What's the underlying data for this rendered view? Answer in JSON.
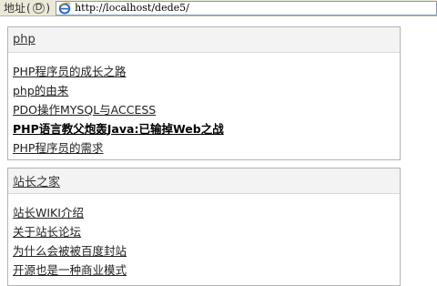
{
  "address_bar": {
    "label": "地址",
    "access_key": "D",
    "url": "http://localhost/dede5/"
  },
  "sections": [
    {
      "title": "php",
      "items": [
        {
          "label": "PHP程序员的成长之路",
          "bold": false
        },
        {
          "label": "php的由来",
          "bold": false
        },
        {
          "label": "PDO操作MYSQL与ACCESS",
          "bold": false
        },
        {
          "label": "PHP语言教父炮轰Java:已输掉Web之战",
          "bold": true
        },
        {
          "label": "PHP程序员的需求",
          "bold": false
        }
      ]
    },
    {
      "title": "站长之家",
      "items": [
        {
          "label": "站长WIKI介绍",
          "bold": false
        },
        {
          "label": "关于站长论坛",
          "bold": false
        },
        {
          "label": "为什么会被被百度封站",
          "bold": false
        },
        {
          "label": "开源也是一种商业模式",
          "bold": false
        }
      ]
    }
  ]
}
